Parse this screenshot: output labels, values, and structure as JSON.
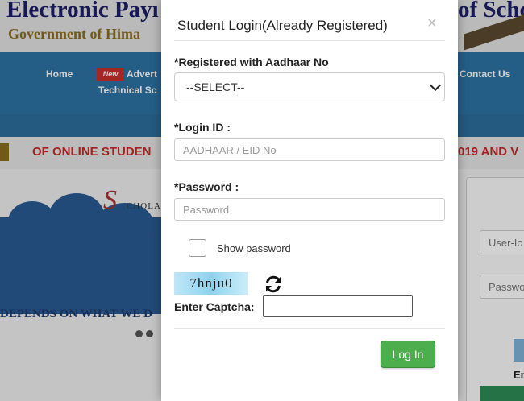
{
  "background": {
    "header_title_left": "Electronic Payı",
    "header_title_right": "of Scho",
    "header_subtitle": "Government of Hima",
    "nav": {
      "home": "Home",
      "new_badge": "New",
      "advert": "Advert",
      "technical": "Technical Sc",
      "contact": "Contact Us"
    },
    "ticker_left": "OF ONLINE STUDEN",
    "ticker_right": "019 AND V",
    "hero_script": "S",
    "hero_scho": "CHOLA",
    "tagline": "DEPENDS ON WHAT WE D",
    "side_user_placeholder": "User-Io",
    "side_pass_placeholder": "Passwo",
    "side_text": "En"
  },
  "modal": {
    "title": "Student Login(Already Registered)",
    "close": "×",
    "aadhaar_label": "*Registered with Aadhaar No",
    "aadhaar_selected": "--SELECT--",
    "login_id_label": "*Login ID :",
    "login_id_placeholder": "AADHAAR / EID No",
    "password_label": "*Password :",
    "password_placeholder": "Password",
    "show_password_label": "Show password",
    "captcha_text": "7hnju0",
    "captcha_label": "Enter Captcha:",
    "login_button": "Log In"
  }
}
